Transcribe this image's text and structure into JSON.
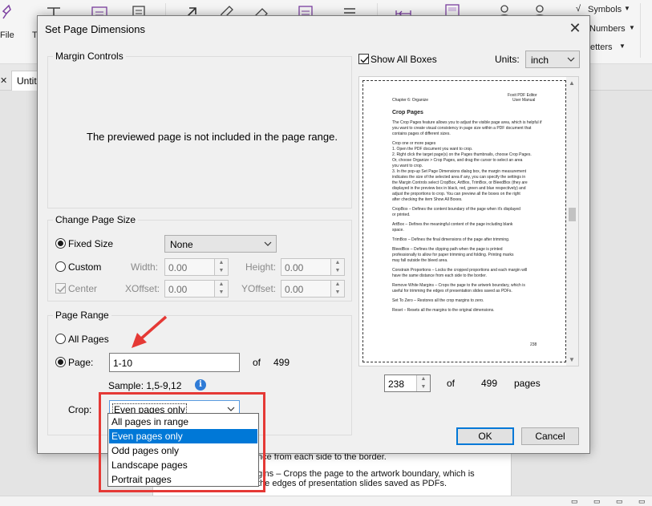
{
  "app": {
    "ribbon": {
      "file_label": "File",
      "t_label": "T",
      "symbols_label": "Symbols",
      "numbers_label": "Numbers",
      "letters_label": "etters"
    },
    "tabs": [
      "Untit"
    ],
    "document_lines": [
      "nce from each side to the border.",
      "gins – Crops the page to the artwork boundary, which is",
      "the edges of presentation slides saved as PDFs."
    ]
  },
  "dialog": {
    "title": "Set Page Dimensions",
    "close_glyph": "✕",
    "margin_controls": {
      "legend": "Margin Controls",
      "message": "The previewed page is not included in the page range."
    },
    "show_all_boxes": {
      "label": "Show All Boxes",
      "checked": true
    },
    "units": {
      "label": "Units:",
      "value": "inch"
    },
    "change_page_size": {
      "legend": "Change Page Size",
      "fixed_size": {
        "label": "Fixed Size",
        "selected": true
      },
      "size_select": "None",
      "custom": {
        "label": "Custom",
        "selected": false
      },
      "width_label": "Width:",
      "width_value": "0.00",
      "height_label": "Height:",
      "height_value": "0.00",
      "center": {
        "label": "Center",
        "checked": true,
        "disabled": true
      },
      "xoffset_label": "XOffset:",
      "xoffset_value": "0.00",
      "yoffset_label": "YOffset:",
      "yoffset_value": "0.00"
    },
    "page_range": {
      "legend": "Page Range",
      "all_pages": {
        "label": "All Pages",
        "selected": false
      },
      "page": {
        "label": "Page:",
        "selected": true,
        "value": "1-10"
      },
      "of_label": "of",
      "total": "499",
      "sample": "Sample: 1,5-9,12",
      "info_glyph": "i",
      "crop_label": "Crop:",
      "crop_value": "Even pages only",
      "crop_options": [
        "All pages in range",
        "Even pages only",
        "Odd pages only",
        "Landscape pages",
        "Portrait pages"
      ],
      "crop_selected_index": 1
    },
    "preview": {
      "current_page": "238",
      "of_label": "of",
      "total": "499",
      "pages_label": "pages",
      "header_right_1": "Foxit PDF Editor",
      "header_right_2": "User Manual",
      "header_left": "Chapter 6: Organize",
      "heading": "Crop Pages",
      "lines": [
        "The Crop Pages feature allows you to adjust the visible page area, which is helpful if",
        "you want to create visual consistency in page size within a PDF document that",
        "contains pages of different sizes.",
        "Crop one or more pages",
        "1.  Open the PDF document you want to crop.",
        "2.  Right click the target page(s) on the Pages thumbnails, choose Crop Pages.",
        "     Or, choose Organize > Crop Pages, and drag the cursor to select an area",
        "     you want to crop.",
        "3.  In the pop-up Set Page Dimensions dialog box, the margin measurement",
        "     indicates the size of the selected area if any, you can specify the settings in",
        "     the Margin Controls select CropBox, ArtBox, TrimBox, or BleedBox (they are",
        "     displayed in the preview box in black, red, green and blue respectively) and",
        "     adjust the proportions to crop. You can preview all the boxes on the right",
        "     after checking the item Show All Boxes.",
        "     CropBox – Defines the content boundary of the page when it's displayed",
        "     or printed.",
        "     ArtBox – Defines the meaningful content of the page including blank",
        "     space.",
        "     TrimBox – Defines the final dimensions of the page after trimming.",
        "     BleedBox – Defines the clipping path when the page is printed",
        "     professionally to allow for paper trimming and folding. Printing marks",
        "     may fall outside the bleed area.",
        "Constrain Proportions – Locks the cropped proportions and each margin will",
        "have the same distance from each side to the border.",
        "Remove White Margins – Crops the page to the artwork boundary, which is",
        "useful for trimming the edges of presentation slides saved as PDFs.",
        "Set To Zero – Restores all the crop margins to zero.",
        "Reset – Resets all the margins to the original dimensions."
      ],
      "page_number": "238"
    },
    "ok_label": "OK",
    "cancel_label": "Cancel"
  },
  "annotation_colors": {
    "arrow": "#e53935",
    "highlight_box": "#e53935"
  },
  "accent_color": "#0078d7"
}
